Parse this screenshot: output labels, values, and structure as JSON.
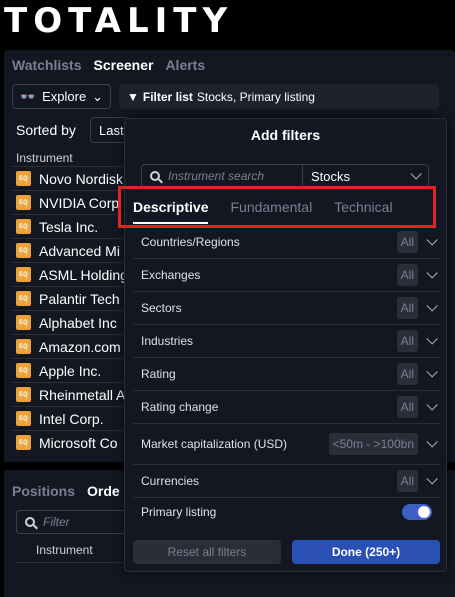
{
  "brand": {
    "logo": "TOTALITY"
  },
  "screener": {
    "tabs": [
      "Watchlists",
      "Screener",
      "Alerts"
    ],
    "explore_label": "Explore",
    "filter_list_label": "Filter list",
    "filter_list_value": "Stocks, Primary listing",
    "sorted_by": "Sorted by",
    "sort_value": "Last",
    "instrument_header": "Instrument",
    "eq_badge": "EQ",
    "rows": [
      "Novo Nordisk",
      "NVIDIA Corp",
      "Tesla Inc.",
      "Advanced Mi",
      "ASML Holding",
      "Palantir Tech",
      "Alphabet Inc",
      "Amazon.com",
      "Apple Inc.",
      "Rheinmetall A",
      "Intel Corp.",
      "Microsoft Co"
    ]
  },
  "bottom": {
    "tabs": [
      "Positions",
      "Orde"
    ],
    "filter_placeholder": "Filter",
    "instrument_header": "Instrument"
  },
  "modal": {
    "title": "Add filters",
    "search_placeholder": "Instrument search",
    "asset_select": "Stocks",
    "tabs": [
      "Descriptive",
      "Fundamental",
      "Technical"
    ],
    "filters": [
      {
        "label": "Countries/Regions",
        "value": "All"
      },
      {
        "label": "Exchanges",
        "value": "All"
      },
      {
        "label": "Sectors",
        "value": "All"
      },
      {
        "label": "Industries",
        "value": "All"
      },
      {
        "label": "Rating",
        "value": "All"
      },
      {
        "label": "Rating change",
        "value": "All"
      },
      {
        "label": "Market capitalization (USD)",
        "value": "<50m - >100bn"
      },
      {
        "label": "Currencies",
        "value": "All"
      }
    ],
    "primary_listing_label": "Primary listing",
    "primary_listing_on": true,
    "reset_label": "Reset all filters",
    "done_label": "Done (250+)"
  },
  "colors": {
    "accent": "#2a50b3",
    "highlight": "#e02424",
    "eq_badge": "#e8a33a"
  }
}
